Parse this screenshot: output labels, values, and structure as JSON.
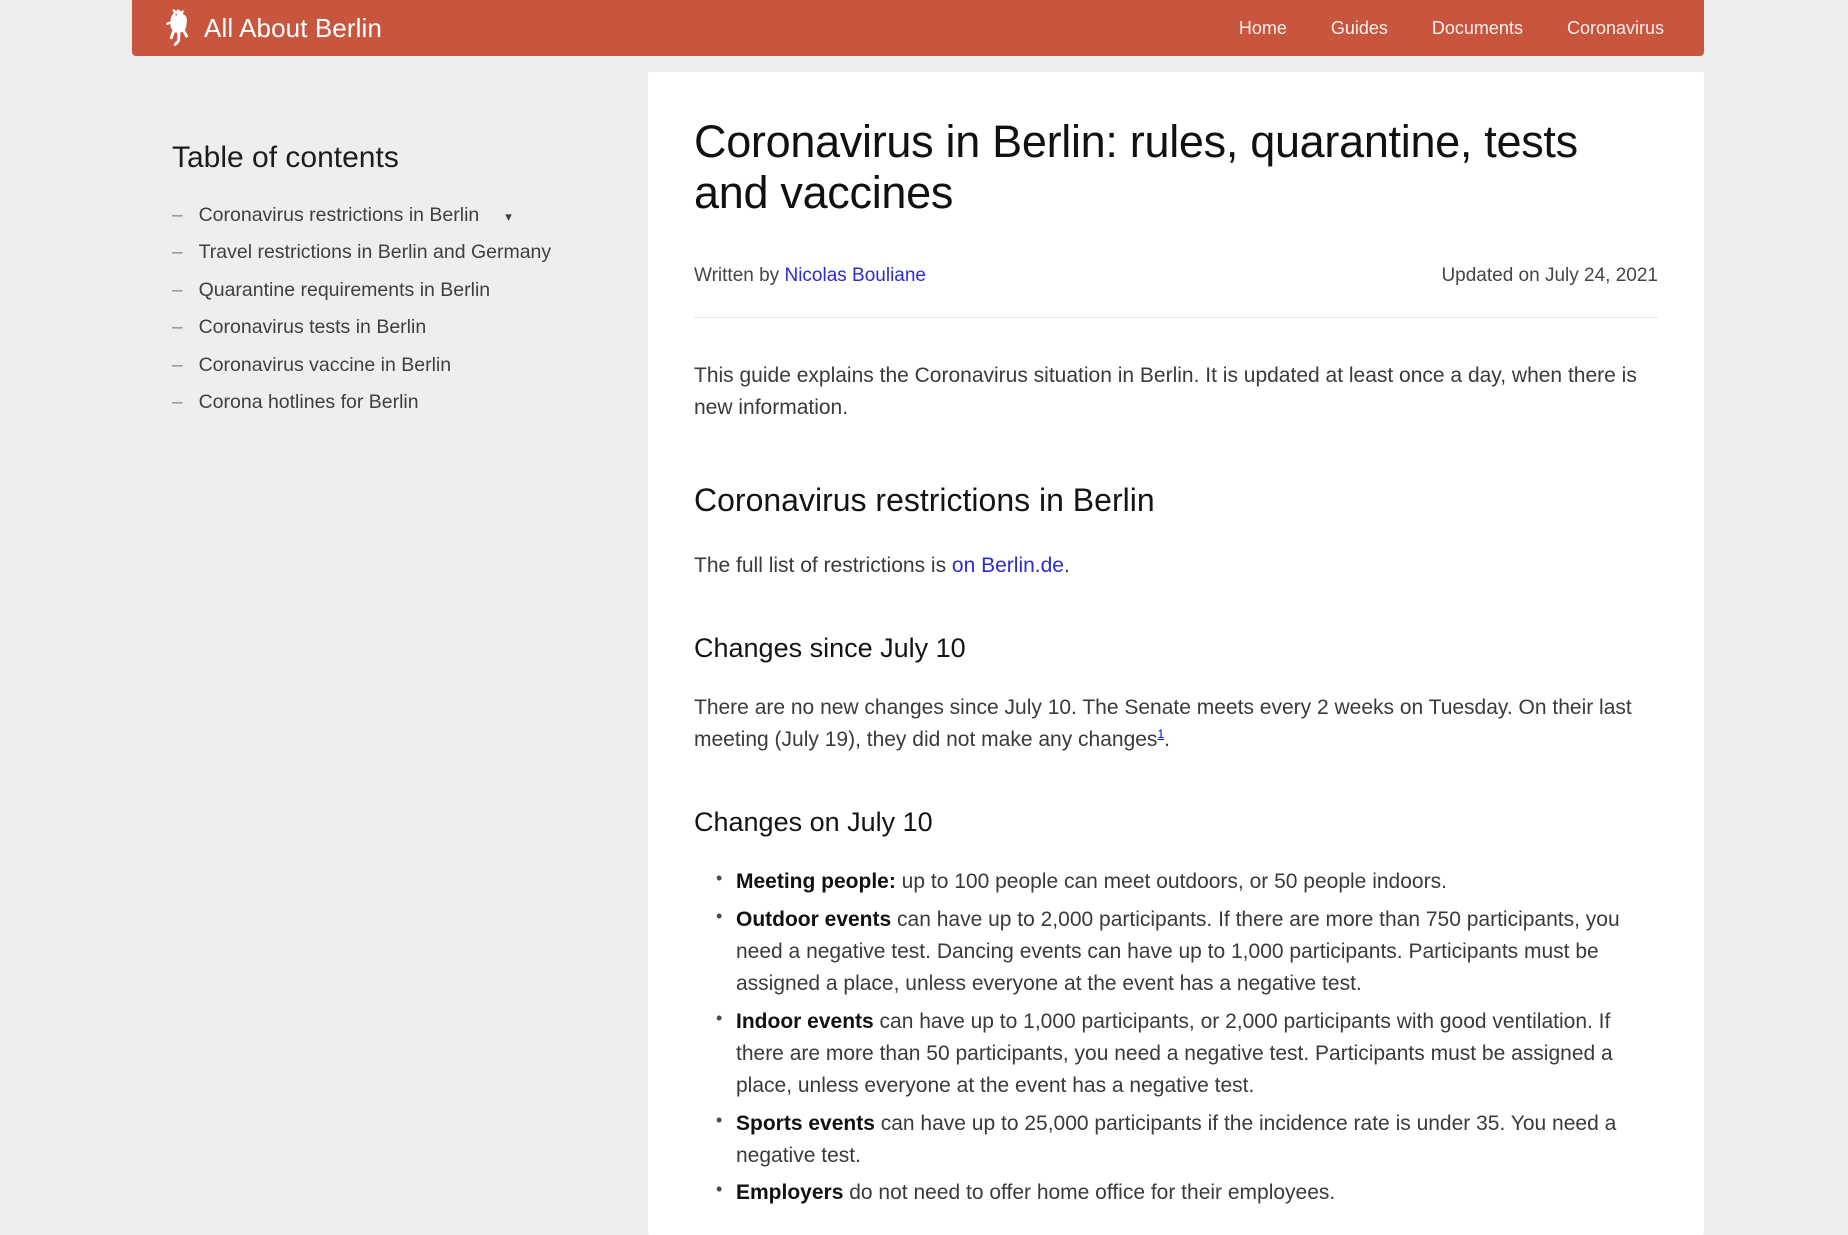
{
  "header": {
    "logo_icon": "berlin-bear-icon",
    "brand": "All About Berlin",
    "nav": [
      {
        "label": "Home"
      },
      {
        "label": "Guides"
      },
      {
        "label": "Documents"
      },
      {
        "label": "Coronavirus"
      }
    ],
    "background_color": "#c8563f"
  },
  "toc": {
    "title": "Table of contents",
    "dash": "–",
    "caret": "▾",
    "items": [
      {
        "label": "Coronavirus restrictions in Berlin",
        "has_caret": true
      },
      {
        "label": "Travel restrictions in Berlin and Germany",
        "has_caret": false
      },
      {
        "label": "Quarantine requirements in Berlin",
        "has_caret": false
      },
      {
        "label": "Coronavirus tests in Berlin",
        "has_caret": false
      },
      {
        "label": "Coronavirus vaccine in Berlin",
        "has_caret": false
      },
      {
        "label": "Corona hotlines for Berlin",
        "has_caret": false
      }
    ]
  },
  "article": {
    "title": "Coronavirus in Berlin: rules, quarantine, tests and vaccines",
    "written_by_prefix": "Written by ",
    "author": "Nicolas Bouliane",
    "updated": "Updated on July 24, 2021",
    "intro": "This guide explains the Coronavirus situation in Berlin. It is updated at least once a day, when there is new information.",
    "section_restrictions_heading": "Coronavirus restrictions in Berlin",
    "full_list_prefix": "The full list of restrictions is ",
    "full_list_link": "on Berlin.de",
    "full_list_suffix": ".",
    "changes_since_heading": "Changes since July 10",
    "changes_since_text_a": "There are no new changes since July 10. The Senate meets every 2 weeks on Tuesday. On their last meeting (July 19), they did not make any changes",
    "changes_since_footnote": "1",
    "changes_since_text_b": ".",
    "changes_on_heading": "Changes on July 10",
    "rules": [
      {
        "bold": "Meeting people:",
        "text": " up to 100 people can meet outdoors, or 50 people indoors."
      },
      {
        "bold": "Outdoor events",
        "text": " can have up to 2,000 participants. If there are more than 750 participants, you need a negative test. Dancing events can have up to 1,000 participants. Participants must be assigned a place, unless everyone at the event has a negative test."
      },
      {
        "bold": "Indoor events",
        "text": " can have up to 1,000 participants, or 2,000 participants with good ventilation. If there are more than 50 participants, you need a negative test. Participants must be assigned a place, unless everyone at the event has a negative test."
      },
      {
        "bold": "Sports events",
        "text": " can have up to 25,000 participants if the incidence rate is under 35. You need a negative test."
      },
      {
        "bold": "Employers",
        "text": " do not need to offer home office for their employees."
      }
    ]
  },
  "colors": {
    "brand_red": "#c8563f",
    "link_blue": "#2b2bd6",
    "page_background": "#eeeeee",
    "card_background": "#ffffff"
  }
}
